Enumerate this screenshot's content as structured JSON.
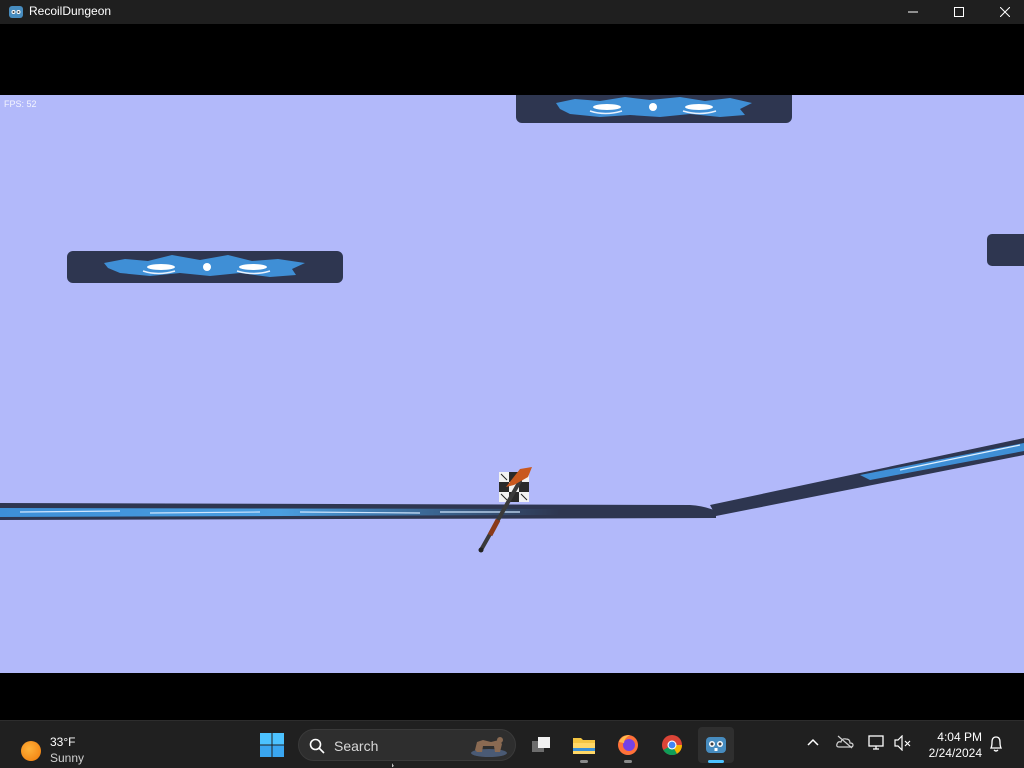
{
  "window": {
    "title": "RecoilDungeon",
    "controls": [
      "minimize",
      "maximize",
      "close"
    ]
  },
  "game": {
    "fps_label": "FPS: 52",
    "background_color": "#b2b9fa",
    "platform_color": "#2e3650",
    "accent_color": "#3f8fd6"
  },
  "taskbar": {
    "weather": {
      "temperature": "33°F",
      "condition": "Sunny",
      "icon": "sun-icon"
    },
    "search": {
      "placeholder": "Search"
    },
    "pinned_apps": [
      {
        "name": "task-view",
        "icon": "task-view-icon"
      },
      {
        "name": "file-explorer",
        "icon": "folder-icon"
      },
      {
        "name": "firefox",
        "icon": "firefox-icon"
      },
      {
        "name": "chrome",
        "icon": "chrome-icon"
      },
      {
        "name": "godot",
        "icon": "godot-icon",
        "active": true
      }
    ],
    "tray": [
      "chevron-up-icon",
      "onedrive-icon",
      "display-icon",
      "speaker-muted-icon",
      "bell-icon"
    ],
    "clock": {
      "time": "4:04 PM",
      "date": "2/24/2024"
    }
  }
}
